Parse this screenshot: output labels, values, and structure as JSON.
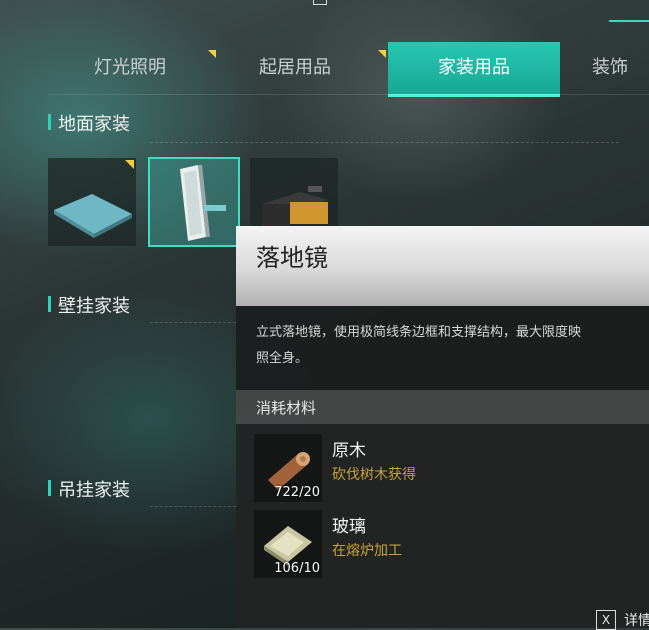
{
  "tabs": [
    {
      "label": "灯光照明",
      "badge": true
    },
    {
      "label": "起居用品",
      "badge": true
    },
    {
      "label": "家装用品",
      "badge": false,
      "active": true
    },
    {
      "label": "装饰",
      "badge": false
    }
  ],
  "sections": {
    "floor": "地面家装",
    "wall": "壁挂家装",
    "hanging": "吊挂家装"
  },
  "tooltip": {
    "title": "落地镜",
    "description": "立式落地镜，使用极简线条边框和支撑结构，最大限度映\n照全身。",
    "materials_label": "消耗材料",
    "materials": [
      {
        "name": "原木",
        "source": "砍伐树木获得",
        "count": "722/20",
        "icon": "log-icon"
      },
      {
        "name": "玻璃",
        "source": "在熔炉加工",
        "count": "106/10",
        "icon": "glass-icon"
      }
    ]
  },
  "footer": {
    "detail_key": "X",
    "detail_label": "详情"
  },
  "colors": {
    "accent": "#2fd3bd",
    "badge": "#f1d23d",
    "source_text": "#c8a23a"
  }
}
